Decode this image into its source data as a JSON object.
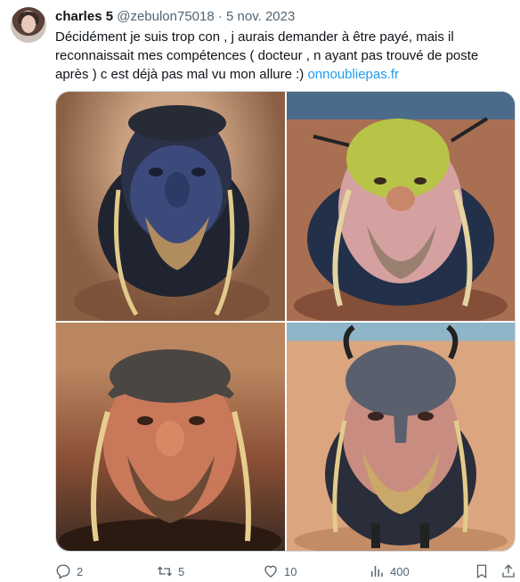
{
  "author": {
    "name": "charles 5",
    "handle": "@zebulon75018",
    "separator": "·",
    "date": "5 nov. 2023"
  },
  "tweet": {
    "text": "Décidément je suis trop con , j aurais demander à être payé, mais il reconnaissait mes compétences ( docteur , n ayant pas trouvé de poste après ) c est déjà pas mal vu mon allure :) ",
    "link": "onnoubliepas.fr"
  },
  "media": {
    "images": [
      {
        "icon": "viking-figure-blue-face"
      },
      {
        "icon": "viking-figure-yellow-face"
      },
      {
        "icon": "viking-figure-helmet"
      },
      {
        "icon": "viking-figure-horned-helmet"
      }
    ]
  },
  "actions": {
    "replies": "2",
    "retweets": "5",
    "likes": "10",
    "views": "400"
  },
  "colors": {
    "link": "#1d9bf0",
    "secondary_text": "#536471",
    "text": "#0f1419"
  }
}
